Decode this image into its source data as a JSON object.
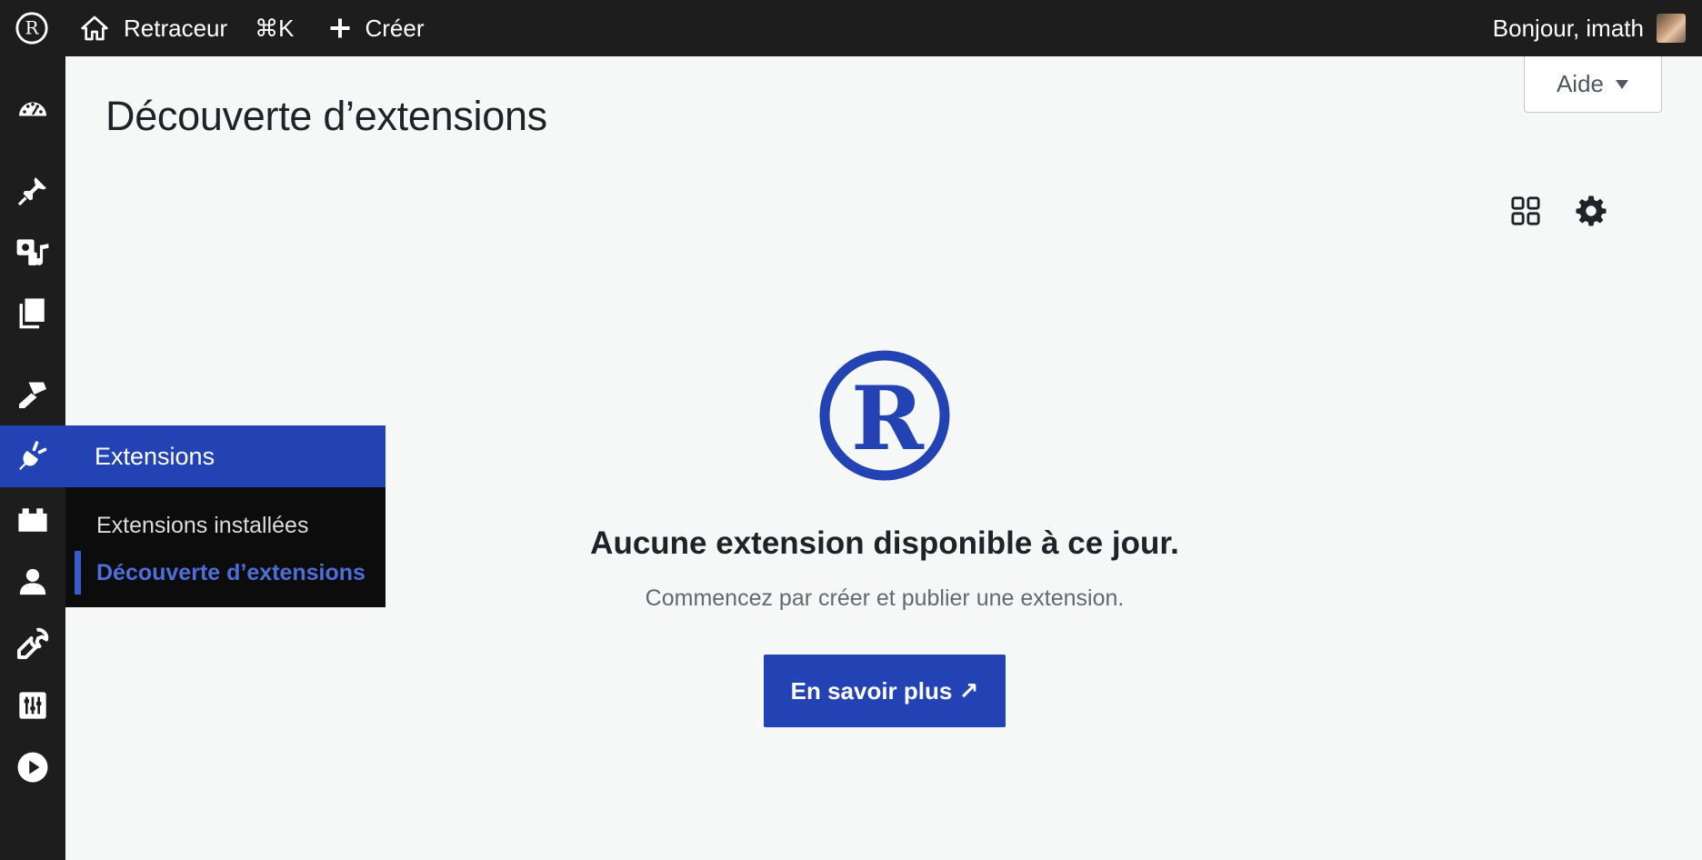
{
  "adminbar": {
    "logo_icon": "registered-r-logo-icon",
    "site_name": "Retraceur",
    "command_shortcut": "⌘K",
    "new_label": "Créer",
    "greeting": "Bonjour, imath"
  },
  "sidebar": {
    "icons": [
      "dashboard-icon",
      "pin-icon",
      "media-icon",
      "pages-icon",
      "appearance-brush-icon",
      "plugin-icon",
      "blocks-icon",
      "users-icon",
      "tools-wrench-icon",
      "settings-sliders-icon",
      "play-icon"
    ],
    "flyout": {
      "title": "Extensions",
      "items": [
        {
          "label": "Extensions installées",
          "current": false
        },
        {
          "label": "Découverte d’extensions",
          "current": true
        }
      ]
    }
  },
  "help": {
    "label": "Aide"
  },
  "page": {
    "title": "Découverte d’extensions"
  },
  "toolbar": {
    "grid_icon": "grid-view-icon",
    "settings_icon": "gear-icon"
  },
  "empty_state": {
    "title": "Aucune extension disponible à ce jour.",
    "text": "Commencez par créer et publier une extension.",
    "button_label": "En savoir plus ↗"
  },
  "colors": {
    "accent": "#2343b5",
    "bar": "#1d1d1d",
    "background": "#f6f7f7"
  }
}
